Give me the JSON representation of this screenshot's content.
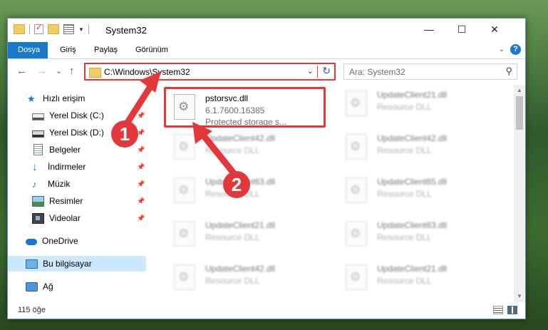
{
  "window": {
    "title": "System32",
    "controls": {
      "minimize": "—",
      "maximize": "☐",
      "close": "✕"
    }
  },
  "ribbon": {
    "tabs": [
      "Dosya",
      "Giriş",
      "Paylaş",
      "Görünüm"
    ],
    "active_tab": "Dosya",
    "help": "?"
  },
  "nav": {
    "back": "←",
    "forward": "→",
    "recent": "⌄",
    "up": "↑",
    "address": "C:\\Windows\\System32",
    "address_caret": "⌄",
    "refresh": "↻",
    "search_placeholder": "Ara: System32"
  },
  "sidebar": {
    "items": [
      {
        "label": "Hızlı erişim",
        "icon": "star-icon"
      },
      {
        "label": "Yerel Disk (C:)",
        "icon": "drive-icon",
        "pinned": true
      },
      {
        "label": "Yerel Disk (D:)",
        "icon": "drive-icon",
        "pinned": true
      },
      {
        "label": "Belgeler",
        "icon": "documents-icon",
        "pinned": true
      },
      {
        "label": "İndirmeler",
        "icon": "download-icon",
        "pinned": true
      },
      {
        "label": "Müzik",
        "icon": "music-icon",
        "pinned": true
      },
      {
        "label": "Resimler",
        "icon": "pictures-icon",
        "pinned": true
      },
      {
        "label": "Videolar",
        "icon": "video-icon",
        "pinned": true
      },
      {
        "label": "OneDrive",
        "icon": "cloud-icon"
      },
      {
        "label": "Bu bilgisayar",
        "icon": "computer-icon",
        "selected": true
      },
      {
        "label": "Ağ",
        "icon": "network-icon"
      }
    ]
  },
  "files": {
    "highlighted": {
      "name": "pstorsvc.dll",
      "line2": "6.1.7600.16385",
      "line3": "Protected storage s..."
    },
    "left_column": [
      {
        "name": "UpdateClient42.dll",
        "type": "Resource DLL"
      },
      {
        "name": "UpdateClient63.dll",
        "type": "Resource DLL"
      },
      {
        "name": "UpdateClient21.dll",
        "type": "Resource DLL"
      },
      {
        "name": "UpdateClient42.dll",
        "type": "Resource DLL"
      }
    ],
    "right_column": [
      {
        "name": "UpdateClient21.dll",
        "type": "Resource DLL"
      },
      {
        "name": "UpdateClient42.dll",
        "type": "Resource DLL"
      },
      {
        "name": "UpdateClient65.dll",
        "type": "Resource DLL"
      },
      {
        "name": "UpdateClient63.dll",
        "type": "Resource DLL"
      },
      {
        "name": "UpdateClient21.dll",
        "type": "Resource DLL"
      }
    ]
  },
  "status": {
    "item_count": "115 öğe"
  },
  "annotations": {
    "step1": "1",
    "step2": "2",
    "color": "#e3383b"
  }
}
